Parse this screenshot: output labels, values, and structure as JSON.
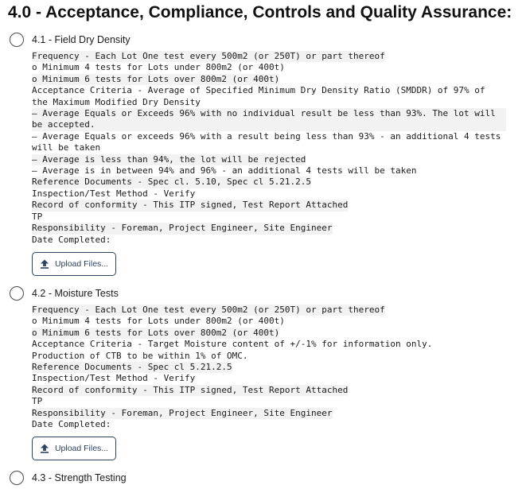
{
  "page_title": "4.0 - Acceptance, Compliance, Controls and Quality Assurance:",
  "upload_label": "Upload Files...",
  "sections": [
    {
      "title": "4.1 - Field Dry Density",
      "lines": [
        "Frequency - Each Lot One test every 500m2 (or 250T) or part thereof",
        "o Minimum 4 tests for Lots under 800m2 (or 400t)",
        "o Minimum 6 tests for Lots over 800m2 (or 400t)",
        "Acceptance Criteria - Average of Specified Minimum Dry Density Ratio (SMDDR) of 97% of the Maximum Modified Dry Density",
        "– Average Equals or Exceeds 96% with no individual result be less than 93%. The lot will be accepted.",
        "– Average Equals or exceeds 96% with a result being less than 93% - an additional 4 tests will be taken",
        "– Average is less than 94%, the lot will be rejected",
        "– Average is in between 94% and 96% - an additional 4 tests will be taken",
        "Reference Documents - Spec cl. 5.10, Spec cl 5.21.2.5",
        "Inspection/Test Method - Verify",
        "Record of conformity - This ITP signed, Test Report Attached",
        "TP",
        "Responsibility - Foreman, Project Engineer, Site Engineer",
        "Date Completed:"
      ]
    },
    {
      "title": "4.2 - Moisture Tests",
      "lines": [
        "Frequency - Each Lot One test every 500m2 (or 250T) or part thereof",
        "o Minimum 4 tests for Lots under 800m2 (or 400t)",
        "o Minimum 6 tests for Lots over 800m2 (or 400t)",
        "Acceptance Criteria - Target Moisture content of +/-1% for information only.",
        "Production of CTB to be within 1% of OMC.",
        "Reference Documents - Spec cl 5.21.2.5",
        "Inspection/Test Method - Verify",
        "Record of conformity - This ITP signed, Test Report Attached",
        "TP",
        "Responsibility - Foreman, Project Engineer, Site Engineer",
        "Date Completed:"
      ]
    },
    {
      "title": "4.3 - Strength Testing",
      "lines": []
    }
  ]
}
